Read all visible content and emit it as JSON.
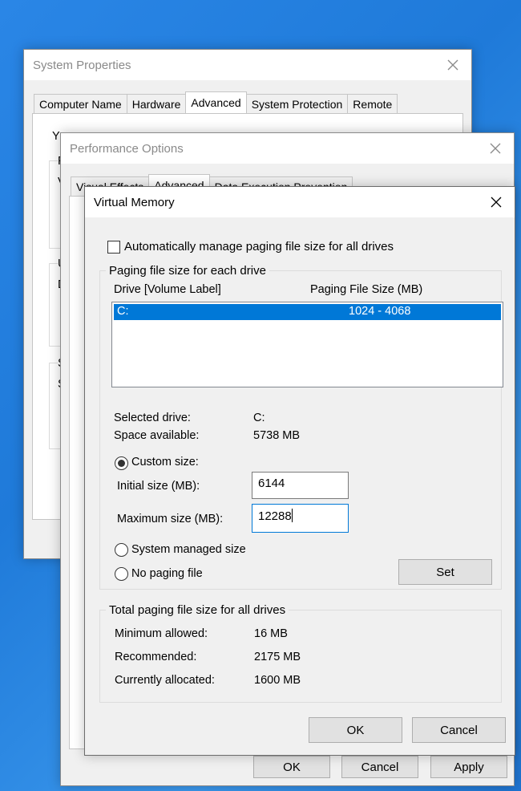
{
  "system_properties": {
    "title": "System Properties",
    "tabs": [
      "Computer Name",
      "Hardware",
      "Advanced",
      "System Protection",
      "Remote"
    ],
    "selected_tab": "Advanced",
    "partial_text": "Y",
    "partial_group_letters": [
      "P",
      "V",
      "U",
      "D",
      "S",
      "S"
    ]
  },
  "performance_options": {
    "title": "Performance Options",
    "tabs": [
      "Visual Effects",
      "Advanced",
      "Data Execution Prevention"
    ],
    "selected_tab": "Advanced",
    "buttons": {
      "ok": "OK",
      "cancel": "Cancel",
      "apply": "Apply"
    }
  },
  "virtual_memory": {
    "title": "Virtual Memory",
    "auto_manage_label": "Automatically manage paging file size for all drives",
    "auto_manage_checked": false,
    "per_drive_group_title": "Paging file size for each drive",
    "columns": {
      "drive": "Drive  [Volume Label]",
      "size": "Paging File Size (MB)"
    },
    "drives": [
      {
        "drive": "C:",
        "size": "1024 - 4068",
        "selected": true
      }
    ],
    "selected_drive_label": "Selected drive:",
    "selected_drive_value": "C:",
    "space_available_label": "Space available:",
    "space_available_value": "5738 MB",
    "custom_size_label": "Custom size:",
    "initial_size_label": "Initial size (MB):",
    "initial_size_value": "6144",
    "maximum_size_label": "Maximum size (MB):",
    "maximum_size_value": "12288",
    "system_managed_label": "System managed size",
    "no_paging_label": "No paging file",
    "selected_option": "custom",
    "set_button": "Set",
    "total_group_title": "Total paging file size for all drives",
    "minimum_allowed_label": "Minimum allowed:",
    "minimum_allowed_value": "16 MB",
    "recommended_label": "Recommended:",
    "recommended_value": "2175 MB",
    "currently_allocated_label": "Currently allocated:",
    "currently_allocated_value": "1600 MB",
    "ok_button": "OK",
    "cancel_button": "Cancel"
  },
  "colors": {
    "accent": "#0078d7",
    "desktop": "#2a86e6",
    "dialog_bg": "#f0f0f0"
  }
}
